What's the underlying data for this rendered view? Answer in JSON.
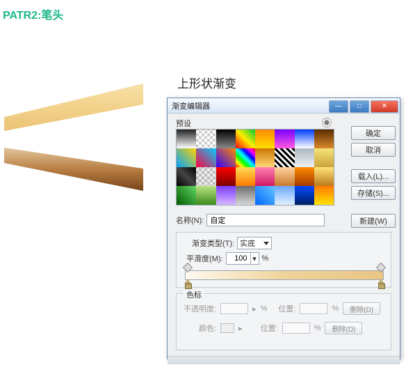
{
  "page": {
    "title": "PATR2:笔头",
    "section_label": "上形状渐变"
  },
  "dialog": {
    "title": "渐变编辑器",
    "window_buttons": {
      "min": "—",
      "max": "□",
      "close": "✕"
    },
    "presets_label": "预设",
    "gear_icon": "gear-icon",
    "buttons": {
      "ok": "确定",
      "cancel": "取消",
      "load": "载入(L)...",
      "save": "存储(S)...",
      "new": "新建(W)"
    },
    "name_label": "名称(N):",
    "name_value": "自定",
    "gradient_type_label": "渐变类型(T):",
    "gradient_type_value": "实底",
    "smoothness_label": "平滑度(M):",
    "smoothness_value": "100",
    "percent": "%",
    "stops_legend": "色标",
    "opacity_label": "不透明度:",
    "position_label": "位置:",
    "color_label": "颜色:",
    "delete_label": "删除(D)"
  }
}
